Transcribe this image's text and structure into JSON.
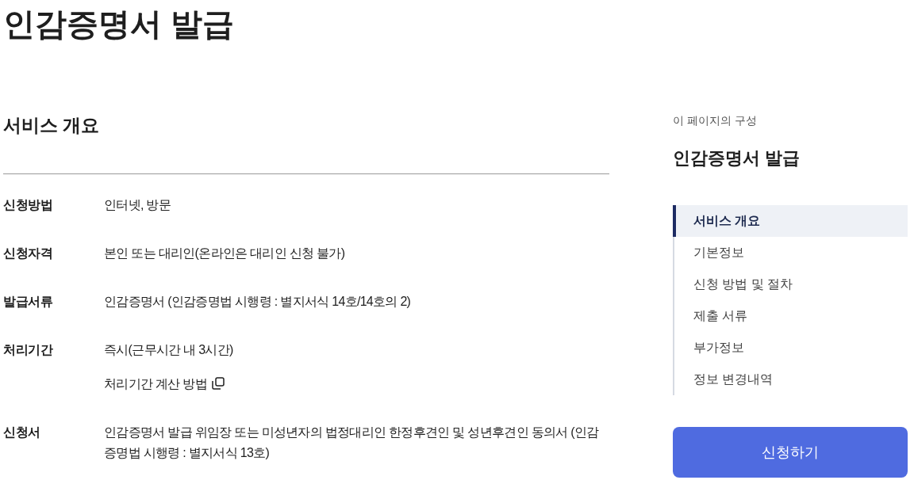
{
  "page_title": "인감증명서 발급",
  "overview": {
    "heading": "서비스 개요",
    "rows": [
      {
        "label": "신청방법",
        "values": [
          {
            "kind": "text",
            "text": "인터넷, 방문"
          }
        ]
      },
      {
        "label": "신청자격",
        "values": [
          {
            "kind": "text",
            "text": "본인 또는 대리인(온라인은 대리인 신청 불가)"
          }
        ]
      },
      {
        "label": "발급서류",
        "values": [
          {
            "kind": "text",
            "text": "인감증명서 (인감증명법 시행령 : 별지서식 14호/14호의 2)"
          }
        ]
      },
      {
        "label": "처리기간",
        "values": [
          {
            "kind": "text",
            "text": "즉시(근무시간 내 3시간)"
          },
          {
            "kind": "link",
            "text": "처리기간 계산 방법"
          }
        ]
      },
      {
        "label": "신청서",
        "values": [
          {
            "kind": "text",
            "text": "인감증명서 발급 위임장 또는 미성년자의 법정대리인 한정후견인 및 성년후견인 동의서 (인감증명법 시행령 : 별지서식 13호)"
          }
        ]
      }
    ]
  },
  "toc": {
    "caption": "이 페이지의 구성",
    "title": "인감증명서 발급",
    "items": [
      {
        "label": "서비스 개요",
        "selected": true
      },
      {
        "label": "기본정보",
        "selected": false
      },
      {
        "label": "신청 방법 및 절차",
        "selected": false
      },
      {
        "label": "제출 서류",
        "selected": false
      },
      {
        "label": "부가정보",
        "selected": false
      },
      {
        "label": "정보 변경내역",
        "selected": false
      }
    ]
  },
  "apply_button": "신청하기"
}
